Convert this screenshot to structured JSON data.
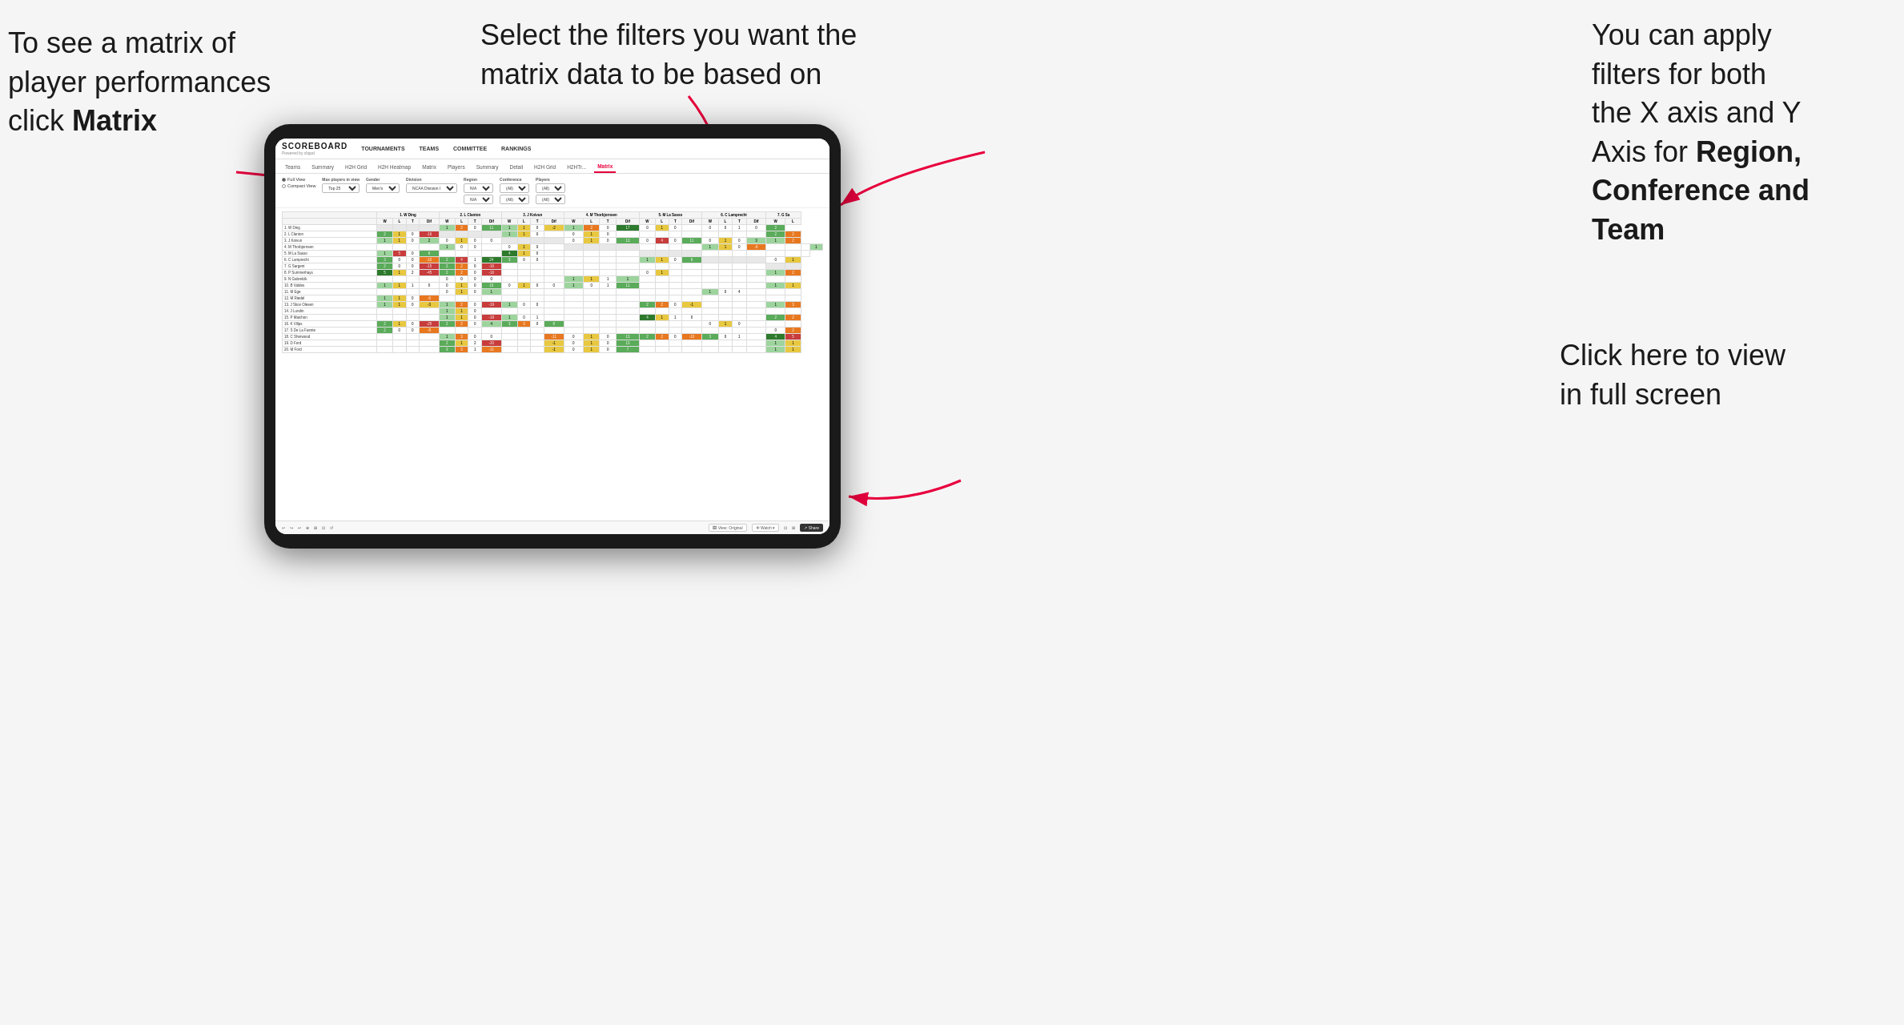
{
  "annotations": {
    "topleft": {
      "line1": "To see a matrix of",
      "line2": "player performances",
      "line3": "click ",
      "line3bold": "Matrix"
    },
    "topmid": {
      "text": "Select the filters you want the matrix data to be based on"
    },
    "topright": {
      "line1": "You  can apply",
      "line2": "filters for both",
      "line3": "the X axis and Y",
      "line4": "Axis for ",
      "line4bold": "Region,",
      "line5bold": "Conference and",
      "line6bold": "Team"
    },
    "bottomright": {
      "line1": "Click here to view",
      "line2": "in full screen"
    }
  },
  "nav": {
    "logo": "SCOREBOARD",
    "logo_sub": "Powered by clippd",
    "items": [
      "TOURNAMENTS",
      "TEAMS",
      "COMMITTEE",
      "RANKINGS"
    ]
  },
  "tabs": {
    "items": [
      "Teams",
      "Summary",
      "H2H Grid",
      "H2H Heatmap",
      "Matrix",
      "Players",
      "Summary",
      "Detail",
      "H2H Grid",
      "H2HTr...",
      "Matrix"
    ],
    "active": "Matrix"
  },
  "filters": {
    "view_options": [
      "Full View",
      "Compact View"
    ],
    "selected_view": "Full View",
    "max_players_label": "Max players in view",
    "max_players_value": "Top 25",
    "gender_label": "Gender",
    "gender_value": "Men's",
    "division_label": "Division",
    "division_value": "NCAA Division I",
    "region_label": "Region",
    "region_value1": "N/A",
    "region_value2": "N/A",
    "conference_label": "Conference",
    "conference_value1": "(All)",
    "conference_value2": "(All)",
    "players_label": "Players",
    "players_value1": "(All)",
    "players_value2": "(All)"
  },
  "matrix": {
    "col_headers": [
      "1. W Ding",
      "2. L Clanton",
      "3. J Koivun",
      "4. M Thorbjornsen",
      "5. M La Sasso",
      "6. C Lamprecht",
      "7. G Sa"
    ],
    "sub_headers": [
      "W",
      "L",
      "T",
      "Dif"
    ],
    "rows": [
      {
        "name": "1. W Ding",
        "cells": [
          [
            "",
            "",
            "",
            ""
          ],
          [
            "1",
            "2",
            "0",
            "11"
          ],
          [
            "1",
            "1",
            "0",
            "-2"
          ],
          [
            "1",
            "2",
            "0",
            "17"
          ],
          [
            "0",
            "1",
            "0",
            ""
          ],
          [
            "0",
            "0",
            "1",
            "0"
          ],
          [
            "2"
          ]
        ]
      },
      {
        "name": "2. L Clanton",
        "cells": [
          [
            "2",
            "1",
            "0",
            "-16"
          ],
          [
            "",
            "",
            "",
            ""
          ],
          [
            "1",
            "1",
            "0",
            ""
          ],
          [
            "0",
            "1",
            "0",
            ""
          ],
          [
            "",
            "",
            "",
            ""
          ],
          [
            "",
            "",
            "",
            ""
          ],
          [
            "2",
            "2"
          ]
        ]
      },
      {
        "name": "3. J Koivun",
        "cells": [
          [
            "1",
            "1",
            "0",
            "2"
          ],
          [
            "0",
            "1",
            "0",
            "0"
          ],
          [
            "",
            "",
            "",
            ""
          ],
          [
            "0",
            "1",
            "0",
            "13"
          ],
          [
            "0",
            "4",
            "0",
            "11"
          ],
          [
            "0",
            "1",
            "0",
            "3"
          ],
          [
            "1",
            "2"
          ]
        ]
      },
      {
        "name": "4. M Thorbjornsen",
        "cells": [
          [
            "",
            "",
            "",
            ""
          ],
          [
            "1",
            "0",
            "0",
            ""
          ],
          [
            "0",
            "1",
            "0",
            ""
          ],
          [
            "",
            "",
            "",
            ""
          ],
          [
            "",
            "",
            "",
            ""
          ],
          [
            "1",
            "1",
            "0",
            "-6"
          ],
          [
            "",
            "",
            "",
            "1"
          ]
        ]
      },
      {
        "name": "5. M La Sasso",
        "cells": [
          [
            "1",
            "5",
            "0",
            "6"
          ],
          [
            "",
            "",
            "",
            ""
          ],
          [
            "4",
            "1",
            "0",
            ""
          ],
          [
            "",
            "",
            "",
            ""
          ],
          [
            "",
            "",
            "",
            ""
          ],
          [
            "",
            "",
            "",
            ""
          ],
          [
            "",
            "",
            ""
          ]
        ]
      },
      {
        "name": "6. C Lamprecht",
        "cells": [
          [
            "3",
            "0",
            "0",
            "-10"
          ],
          [
            "2",
            "4",
            "1",
            "24"
          ],
          [
            "3",
            "0",
            "0",
            ""
          ],
          [
            "",
            "",
            "",
            ""
          ],
          [
            "1",
            "1",
            "0",
            "6"
          ],
          [
            "",
            "",
            "",
            ""
          ],
          [
            "0",
            "1"
          ]
        ]
      },
      {
        "name": "7. G Sargent",
        "cells": [
          [
            "2",
            "0",
            "0",
            "-15"
          ],
          [
            "2",
            "2",
            "0",
            "-16"
          ],
          [
            "",
            "",
            "",
            ""
          ],
          [
            "",
            "",
            "",
            ""
          ],
          [
            "",
            "",
            "",
            ""
          ],
          [
            "",
            "",
            "",
            ""
          ],
          [
            "",
            ""
          ]
        ]
      },
      {
        "name": "8. P Summerhays",
        "cells": [
          [
            "5",
            "1",
            "2",
            "-45"
          ],
          [
            "2",
            "2",
            "0",
            "-16"
          ],
          [
            "",
            "",
            "",
            ""
          ],
          [
            "",
            "",
            "",
            ""
          ],
          [
            "0",
            "1",
            "",
            ""
          ],
          [
            "",
            "",
            "",
            ""
          ],
          [
            "1",
            "2"
          ]
        ]
      },
      {
        "name": "9. N Gabrelcik",
        "cells": [
          [
            "",
            "",
            "",
            ""
          ],
          [
            "0",
            "0",
            "0",
            "0"
          ],
          [
            "",
            "",
            "",
            ""
          ],
          [
            "1",
            "1",
            "1",
            "1"
          ],
          [
            "",
            "",
            "",
            ""
          ],
          [
            "",
            "",
            "",
            ""
          ],
          [
            "",
            ""
          ]
        ]
      },
      {
        "name": "10. B Valdes",
        "cells": [
          [
            "1",
            "1",
            "1",
            "0"
          ],
          [
            "0",
            "1",
            "0",
            "10"
          ],
          [
            "0",
            "1",
            "0",
            "0"
          ],
          [
            "1",
            "0",
            "1",
            "11"
          ],
          [
            "",
            "",
            "",
            ""
          ],
          [
            "",
            "",
            "",
            ""
          ],
          [
            "1",
            "1"
          ]
        ]
      },
      {
        "name": "11. M Ege",
        "cells": [
          [
            "",
            "",
            "",
            ""
          ],
          [
            "0",
            "1",
            "0",
            "1"
          ],
          [
            "",
            "",
            "",
            ""
          ],
          [
            "",
            "",
            "",
            ""
          ],
          [
            "",
            "",
            "",
            ""
          ],
          [
            "1",
            "0",
            "4",
            ""
          ],
          [
            "",
            ""
          ]
        ]
      },
      {
        "name": "12. M Riedel",
        "cells": [
          [
            "1",
            "1",
            "0",
            "-6"
          ],
          [
            "",
            "",
            "",
            ""
          ],
          [
            "",
            "",
            "",
            ""
          ],
          [
            "",
            "",
            "",
            ""
          ],
          [
            "",
            "",
            "",
            ""
          ],
          [
            "",
            "",
            "",
            ""
          ],
          [
            "",
            ""
          ]
        ]
      },
      {
        "name": "13. J Skov Olesen",
        "cells": [
          [
            "1",
            "1",
            "0",
            "-3"
          ],
          [
            "1",
            "2",
            "0",
            "-19"
          ],
          [
            "1",
            "0",
            "0",
            ""
          ],
          [
            "",
            "",
            "",
            ""
          ],
          [
            "2",
            "2",
            "0",
            "-1"
          ],
          [
            "",
            "",
            "",
            ""
          ],
          [
            "1",
            "3"
          ]
        ]
      },
      {
        "name": "14. J Lundin",
        "cells": [
          [
            "",
            "",
            "",
            ""
          ],
          [
            "1",
            "1",
            "0",
            ""
          ],
          [
            "",
            "",
            "",
            ""
          ],
          [
            "",
            "",
            "",
            ""
          ],
          [
            "",
            "",
            "",
            ""
          ],
          [
            "",
            "",
            "",
            ""
          ],
          [
            "",
            ""
          ]
        ]
      },
      {
        "name": "15. P Maichon",
        "cells": [
          [
            "",
            "",
            "",
            ""
          ],
          [
            "1",
            "1",
            "0",
            "-19"
          ],
          [
            "1",
            "0",
            "1",
            ""
          ],
          [
            "",
            "",
            "",
            ""
          ],
          [
            "4",
            "1",
            "1",
            "0"
          ],
          [
            "",
            "",
            "",
            ""
          ],
          [
            "2",
            "2"
          ]
        ]
      },
      {
        "name": "16. K Vilips",
        "cells": [
          [
            "2",
            "1",
            "0",
            "-25"
          ],
          [
            "2",
            "2",
            "0",
            "4"
          ],
          [
            "3",
            "3",
            "0",
            "8"
          ],
          [
            "",
            "",
            "",
            ""
          ],
          [
            "",
            "",
            "",
            ""
          ],
          [
            "0",
            "1",
            "0",
            ""
          ],
          [
            "",
            ""
          ]
        ]
      },
      {
        "name": "17. S De La Fuente",
        "cells": [
          [
            "2",
            "0",
            "0",
            "-8"
          ],
          [
            "",
            "",
            "",
            ""
          ],
          [
            "",
            "",
            "",
            ""
          ],
          [
            "",
            "",
            "",
            ""
          ],
          [
            "",
            "",
            "",
            ""
          ],
          [
            "",
            "",
            "",
            ""
          ],
          [
            "0",
            "2"
          ]
        ]
      },
      {
        "name": "18. C Sherwood",
        "cells": [
          [
            "",
            "",
            "",
            ""
          ],
          [
            "1",
            "3",
            "0",
            "0"
          ],
          [
            "",
            "",
            "",
            "-11"
          ],
          [
            "0",
            "1",
            "0",
            "13"
          ],
          [
            "2",
            "2",
            "0",
            "-10"
          ],
          [
            "3",
            "0",
            "1",
            ""
          ],
          [
            "4",
            "5"
          ]
        ]
      },
      {
        "name": "19. D Ford",
        "cells": [
          [
            "",
            "",
            "",
            ""
          ],
          [
            "2",
            "1",
            "2",
            "-20"
          ],
          [
            "",
            "",
            "",
            "-1"
          ],
          [
            "0",
            "1",
            "0",
            "13"
          ],
          [
            "",
            "",
            "",
            ""
          ],
          [
            "",
            "",
            "",
            ""
          ],
          [
            "1",
            "1"
          ]
        ]
      },
      {
        "name": "20. M Ford",
        "cells": [
          [
            "",
            "",
            "",
            ""
          ],
          [
            "3",
            "3",
            "1",
            "-11"
          ],
          [
            "",
            "",
            "",
            "-1"
          ],
          [
            "0",
            "1",
            "0",
            "7"
          ],
          [
            "",
            "",
            "",
            ""
          ],
          [
            "",
            "",
            "",
            ""
          ],
          [
            "1",
            "1"
          ]
        ]
      }
    ]
  },
  "toolbar": {
    "buttons": [
      "↩",
      "↪",
      "↩",
      "⊕",
      "⊞+",
      "⊡",
      "↺"
    ],
    "view_label": "View: Original",
    "watch_label": "Watch ▾",
    "share_label": "Share"
  },
  "colors": {
    "accent": "#e8003d",
    "arrow": "#e8003d",
    "dark": "#1a1a1a"
  }
}
